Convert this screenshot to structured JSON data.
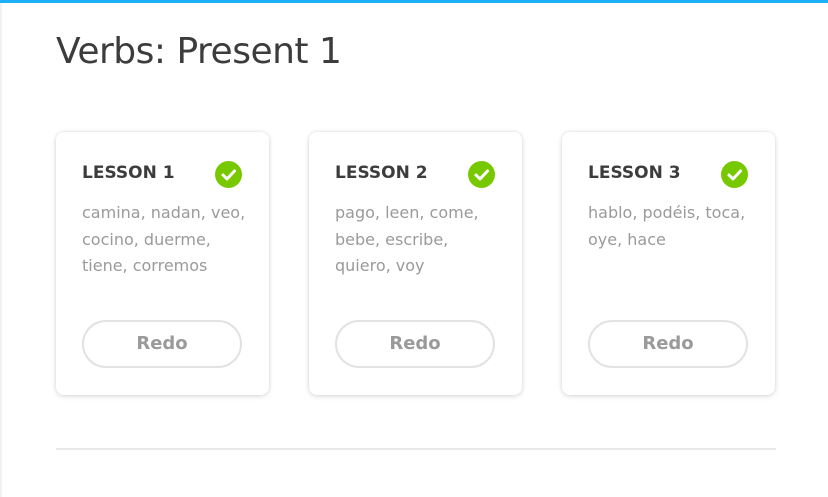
{
  "skill": {
    "title": "Verbs: Present 1"
  },
  "lessons": [
    {
      "title": "LESSON 1",
      "words": "camina, nadan, veo, cocino, duerme, tiene, corremos",
      "completed": true,
      "status_icon": "check-circle-icon",
      "button_label": "Redo"
    },
    {
      "title": "LESSON 2",
      "words": "pago, leen, come, bebe, escribe, quiero, voy",
      "completed": true,
      "status_icon": "check-circle-icon",
      "button_label": "Redo"
    },
    {
      "title": "LESSON 3",
      "words": "hablo, podéis, toca, oye, hace",
      "completed": true,
      "status_icon": "check-circle-icon",
      "button_label": "Redo"
    }
  ],
  "colors": {
    "accent_bar": "#1cb0f6",
    "check_green": "#78c800",
    "title_text": "#3c3c3c",
    "muted_text": "#9a9a9a",
    "button_border": "#e2e2e2"
  }
}
